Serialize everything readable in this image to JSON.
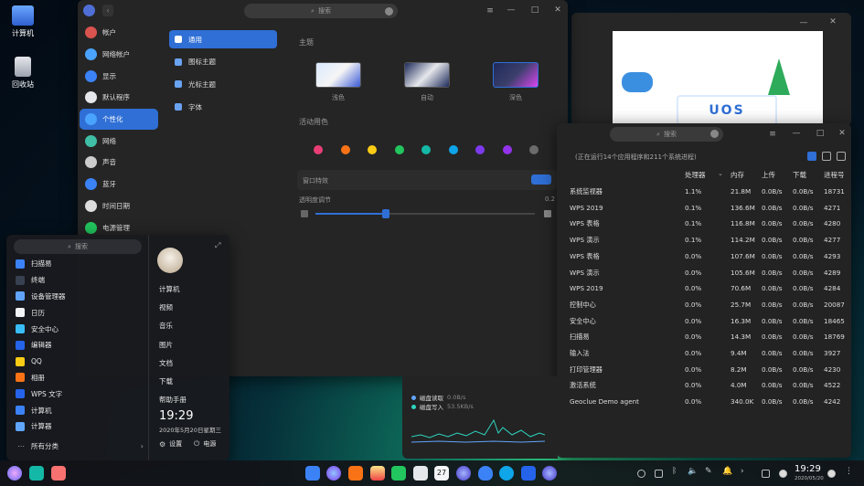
{
  "desktop": {
    "icons": [
      {
        "label": "计算机"
      },
      {
        "label": "回收站"
      }
    ]
  },
  "settings": {
    "search_placeholder": "搜索",
    "nav": [
      {
        "label": "帐户",
        "color": "#d9534f"
      },
      {
        "label": "网络帐户",
        "color": "#4aa3ff"
      },
      {
        "label": "显示",
        "color": "#3b82f6"
      },
      {
        "label": "默认程序",
        "color": "#e5e7eb"
      },
      {
        "label": "个性化",
        "color": "#4aa3ff"
      },
      {
        "label": "网络",
        "color": "#3fbfa5"
      },
      {
        "label": "声音",
        "color": "#cccccc"
      },
      {
        "label": "蓝牙",
        "color": "#3b82f6"
      },
      {
        "label": "时间日期",
        "color": "#dddddd"
      },
      {
        "label": "电源管理",
        "color": "#22c55e"
      }
    ],
    "active_nav": 4,
    "subnav": [
      {
        "label": "通用"
      },
      {
        "label": "图标主题"
      },
      {
        "label": "光标主题"
      },
      {
        "label": "字体"
      }
    ],
    "theme_title": "主题",
    "themes": [
      {
        "label": "浅色"
      },
      {
        "label": "自动"
      },
      {
        "label": "深色"
      }
    ],
    "accent_title": "活动用色",
    "accent_colors": [
      "#e83e75",
      "#f97316",
      "#facc15",
      "#22c55e",
      "#14b8a6",
      "#0ea5e9",
      "#7c3aed",
      "#9333ea",
      "#6b6b6b"
    ],
    "effects_label": "窗口特效",
    "transparency_label": "透明度调节",
    "transparency_value": "0.2",
    "transparency_fraction": 0.32
  },
  "monitor": {
    "search_placeholder": "搜索",
    "summary": "(正在运行14个应用程序和211个系统进程)",
    "columns": [
      "处理器",
      "内存",
      "上传",
      "下载",
      "进程号"
    ],
    "rows": [
      {
        "name": "系统监视器",
        "cpu": "1.1%",
        "mem": "21.8M",
        "up": "0.0B/s",
        "down": "0.0B/s",
        "pid": "18731"
      },
      {
        "name": "WPS 2019",
        "cpu": "0.1%",
        "mem": "136.6M",
        "up": "0.0B/s",
        "down": "0.0B/s",
        "pid": "4271"
      },
      {
        "name": "WPS 表格",
        "cpu": "0.1%",
        "mem": "116.8M",
        "up": "0.0B/s",
        "down": "0.0B/s",
        "pid": "4280"
      },
      {
        "name": "WPS 演示",
        "cpu": "0.1%",
        "mem": "114.2M",
        "up": "0.0B/s",
        "down": "0.0B/s",
        "pid": "4277"
      },
      {
        "name": "WPS 表格",
        "cpu": "0.0%",
        "mem": "107.6M",
        "up": "0.0B/s",
        "down": "0.0B/s",
        "pid": "4293"
      },
      {
        "name": "WPS 演示",
        "cpu": "0.0%",
        "mem": "105.6M",
        "up": "0.0B/s",
        "down": "0.0B/s",
        "pid": "4289"
      },
      {
        "name": "WPS 2019",
        "cpu": "0.0%",
        "mem": "70.6M",
        "up": "0.0B/s",
        "down": "0.0B/s",
        "pid": "4284"
      },
      {
        "name": "控制中心",
        "cpu": "0.0%",
        "mem": "25.7M",
        "up": "0.0B/s",
        "down": "0.0B/s",
        "pid": "20087"
      },
      {
        "name": "安全中心",
        "cpu": "0.0%",
        "mem": "16.3M",
        "up": "0.0B/s",
        "down": "0.0B/s",
        "pid": "18465"
      },
      {
        "name": "扫描易",
        "cpu": "0.0%",
        "mem": "14.3M",
        "up": "0.0B/s",
        "down": "0.0B/s",
        "pid": "18769"
      },
      {
        "name": "输入法",
        "cpu": "0.0%",
        "mem": "9.4M",
        "up": "0.0B/s",
        "down": "0.0B/s",
        "pid": "3927"
      },
      {
        "name": "打印管理器",
        "cpu": "0.0%",
        "mem": "8.2M",
        "up": "0.0B/s",
        "down": "0.0B/s",
        "pid": "4230"
      },
      {
        "name": "激活系统",
        "cpu": "0.0%",
        "mem": "4.0M",
        "up": "0.0B/s",
        "down": "0.0B/s",
        "pid": "4522"
      },
      {
        "name": "Geoclue Demo agent",
        "cpu": "0.0%",
        "mem": "340.0K",
        "up": "0.0B/s",
        "down": "0.0B/s",
        "pid": "4242"
      }
    ]
  },
  "disk": {
    "read_label": "磁盘读取",
    "read_value": "0.0B/s",
    "write_label": "磁盘写入",
    "write_value": "53.5KB/s"
  },
  "uos_logo": "UOS",
  "launcher": {
    "search_placeholder": "搜索",
    "apps": [
      {
        "label": "扫描易",
        "color": "#3b82f6"
      },
      {
        "label": "终端",
        "color": "#374151"
      },
      {
        "label": "设备管理器",
        "color": "#60a5fa"
      },
      {
        "label": "日历",
        "color": "#f3f4f6"
      },
      {
        "label": "安全中心",
        "color": "#38bdf8"
      },
      {
        "label": "编辑器",
        "color": "#2563eb"
      },
      {
        "label": "QQ",
        "color": "#facc15"
      },
      {
        "label": "相册",
        "color": "#f97316"
      },
      {
        "label": "WPS 文字",
        "color": "#2563eb"
      },
      {
        "label": "计算机",
        "color": "#3b82f6"
      },
      {
        "label": "计算器",
        "color": "#60a5fa"
      }
    ],
    "all_categories": "所有分类",
    "places": [
      {
        "label": "计算机"
      },
      {
        "label": "视频"
      },
      {
        "label": "音乐"
      },
      {
        "label": "图片"
      },
      {
        "label": "文档"
      },
      {
        "label": "下载"
      },
      {
        "label": "帮助手册"
      }
    ],
    "time": "19:29",
    "date": "2020年5月20日星期三",
    "settings_label": "设置",
    "power_label": "电源"
  },
  "taskbar": {
    "time": "19:29",
    "date": "2020/05/20",
    "calendar_day": "27"
  }
}
